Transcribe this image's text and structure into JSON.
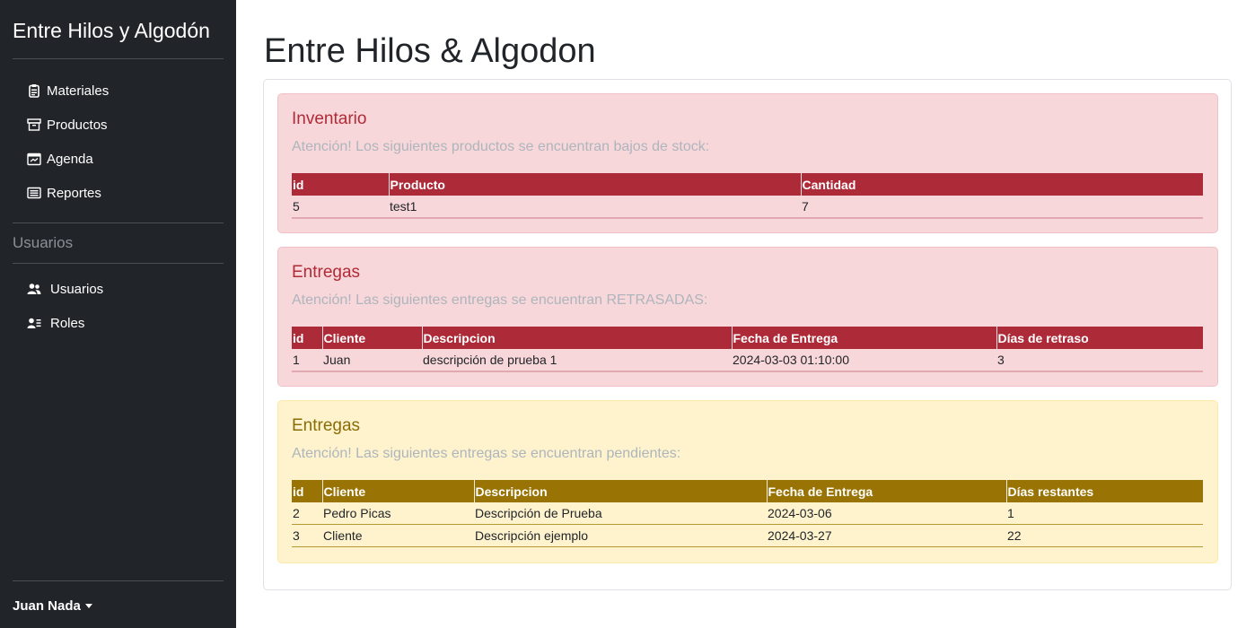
{
  "sidebar": {
    "brand": "Entre Hilos y Algodón",
    "items": [
      {
        "label": "Materiales",
        "icon": "clipboard-icon"
      },
      {
        "label": "Productos",
        "icon": "archive-box-icon"
      },
      {
        "label": "Agenda",
        "icon": "calendar-icon"
      },
      {
        "label": "Reportes",
        "icon": "report-icon"
      }
    ],
    "section_label": "Usuarios",
    "user_items": [
      {
        "label": "Usuarios",
        "icon": "users-icon"
      },
      {
        "label": "Roles",
        "icon": "id-card-icon"
      }
    ],
    "user_name": "Juan Nada"
  },
  "main": {
    "title": "Entre Hilos & Algodon",
    "inventory": {
      "heading": "Inventario",
      "message": "Atención! Los siguientes productos se encuentran bajos de stock:",
      "columns": [
        "id",
        "Producto",
        "Cantidad"
      ],
      "rows": [
        [
          "5",
          "test1",
          "7"
        ]
      ]
    },
    "late_deliveries": {
      "heading": "Entregas",
      "message": "Atención! Las siguientes entregas se encuentran RETRASADAS:",
      "columns": [
        "id",
        "Cliente",
        "Descripcion",
        "Fecha de Entrega",
        "Días de retraso"
      ],
      "rows": [
        [
          "1",
          "Juan",
          "descripción de prueba 1",
          "2024-03-03 01:10:00",
          "3"
        ]
      ]
    },
    "pending_deliveries": {
      "heading": "Entregas",
      "message": "Atención! Las siguientes entregas se encuentran pendientes:",
      "columns": [
        "id",
        "Cliente",
        "Descripcion",
        "Fecha de Entrega",
        "Días restantes"
      ],
      "rows": [
        [
          "2",
          "Pedro Picas",
          "Descripción de Prueba",
          "2024-03-06",
          "1"
        ],
        [
          "3",
          "Cliente",
          "Descripción ejemplo",
          "2024-03-27",
          "22"
        ]
      ]
    }
  },
  "colors": {
    "sidebar_bg": "#212529",
    "danger_bg": "#f8d7da",
    "danger_header": "#ad2b38",
    "warning_bg": "#fff3cd",
    "warning_header": "#997404"
  }
}
